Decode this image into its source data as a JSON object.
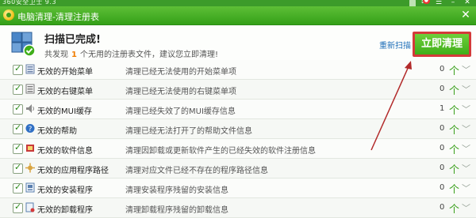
{
  "app": {
    "title": "360安全卫士 9.3"
  },
  "dialog": {
    "title": "电脑清理-清理注册表",
    "close_glyph": "✕"
  },
  "summary": {
    "heading": "扫描已完成!",
    "sub_prefix": "共发现",
    "sub_count": "1",
    "sub_suffix": "个无用的注册表文件，建议您立即清理!",
    "rescan_label": "重新扫描",
    "clean_label": "立即清理"
  },
  "items": [
    {
      "name": "无效的开始菜单",
      "desc": "清理已经无法使用的开始菜单项",
      "count": "0",
      "icon": "start-menu-icon"
    },
    {
      "name": "无效的右键菜单",
      "desc": "清理已经无法使用的右键菜单项",
      "count": "0",
      "icon": "context-menu-icon"
    },
    {
      "name": "无效的MUI缓存",
      "desc": "清理已经失效了的MUI缓存信息",
      "count": "1",
      "icon": "speaker-icon"
    },
    {
      "name": "无效的帮助",
      "desc": "清理已经无法打开了的帮助文件信息",
      "count": "0",
      "icon": "help-icon"
    },
    {
      "name": "无效的软件信息",
      "desc": "清理因卸载或更新软件产生的已经失效的软件注册信息",
      "count": "0",
      "icon": "software-icon"
    },
    {
      "name": "无效的应用程序路径",
      "desc": "清理对应文件已经不存在的程序路径信息",
      "count": "0",
      "icon": "app-path-icon"
    },
    {
      "name": "无效的安装程序",
      "desc": "清理安装程序残留的安装信息",
      "count": "0",
      "icon": "installer-icon"
    },
    {
      "name": "无效的卸载程序",
      "desc": "清理卸载程序残留的卸载信息",
      "count": "0",
      "icon": "uninstaller-icon"
    }
  ],
  "glyphs": {
    "up": "个",
    "more": "﹀"
  },
  "colors": {
    "accent": "#3fae1a",
    "highlight": "#d43a3a",
    "count": "#f07d00"
  }
}
